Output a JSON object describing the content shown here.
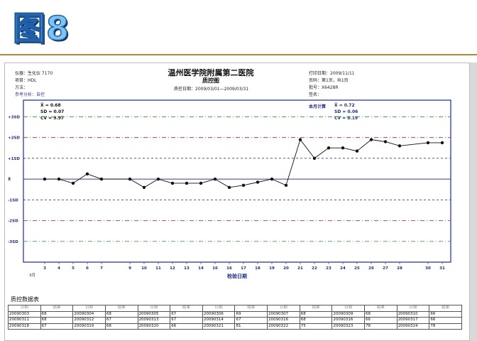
{
  "slide_title": "图8",
  "report": {
    "left_header": [
      "仪器：生化仪  7170",
      "项目：HDL",
      "方法：",
      "参考分析：自控"
    ],
    "hospital": "温州医学院附属第二医院",
    "chart_name": "质控图",
    "period": "质控日期：2009/03/01—2009/03/31",
    "right_header": [
      "打印日期：2009/11/11",
      "页码：第1页，共1页",
      "批号：X6428R",
      "签名："
    ]
  },
  "stats_left": [
    "X̄ = 0.68",
    "SD = 0.07",
    "CV = 9.97"
  ],
  "stats_right_label": "本月计算",
  "stats_right": [
    "X̄ = 0.72",
    "SD = 0.06",
    "CV = 8.19"
  ],
  "chart_data": {
    "type": "line",
    "title": "质控图",
    "xlabel": "检验日期",
    "month_label": "3月",
    "x_ticks": [
      3,
      4,
      5,
      6,
      7,
      9,
      10,
      11,
      12,
      13,
      14,
      16,
      16,
      17,
      18,
      19,
      20,
      21,
      22,
      23,
      24,
      25,
      26,
      27,
      28,
      30,
      31
    ],
    "y_ticks": [
      "+3SD",
      "+2SD",
      "+1SD",
      "X̄",
      "-1SD",
      "-2SD",
      "-3SD"
    ],
    "ylim": [
      -4,
      3.8
    ],
    "line_colors": {
      "sd3": "#3aa63a",
      "sd2": "#d23a3a",
      "sd1": "#2a3aa8",
      "mean": "#2a3aa8"
    },
    "series": [
      {
        "x": [
          3,
          4,
          5,
          6,
          7,
          9,
          10,
          11,
          12,
          13,
          14,
          15,
          16,
          17,
          18,
          19,
          20,
          21,
          22,
          23,
          24,
          25,
          26,
          27,
          28,
          30,
          31
        ],
        "values": [
          0,
          0,
          -0.2,
          0.25,
          0,
          0,
          -0.4,
          0,
          -0.2,
          -0.2,
          -0.2,
          0,
          -0.4,
          -0.3,
          -0.15,
          0,
          -0.3,
          1.9,
          1.0,
          1.5,
          1.5,
          1.35,
          1.9,
          1.8,
          1.6,
          1.75,
          1.75
        ]
      }
    ]
  },
  "table": {
    "title": "质控数据表",
    "header": [
      "日期",
      "结果",
      "日期",
      "结果",
      "日期",
      "结果",
      "日期",
      "结果",
      "日期",
      "结果",
      "日期",
      "结果",
      "日期",
      "结果"
    ],
    "rows": [
      [
        "20090303",
        "68",
        "20090304",
        "68",
        "20090305",
        "67",
        "20090306",
        "69",
        "20090307",
        "68",
        "20090309",
        "68",
        "20090310",
        "66"
      ],
      [
        "20090311",
        "68",
        "20090312",
        "67",
        "20090313",
        "67",
        "20090314",
        "67",
        "20090316",
        "68",
        "20090316",
        "66",
        "20090317",
        "66"
      ],
      [
        "20090318",
        "67",
        "20090319",
        "68",
        "20090320",
        "66",
        "20090321",
        "81",
        "20090322",
        "75",
        "20090323",
        "78",
        "20090324",
        "78"
      ]
    ]
  }
}
